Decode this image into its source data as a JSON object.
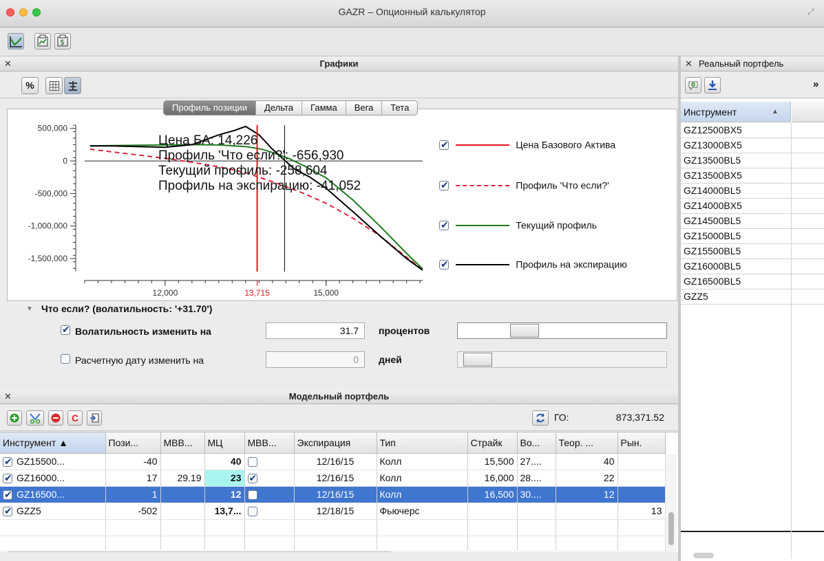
{
  "window": {
    "title": "GAZR – Опционный калькулятор"
  },
  "graphs_panel": {
    "title": "Графики",
    "toolbar": {
      "percent_label": "%"
    },
    "tabs": [
      {
        "label": "Профиль позиции",
        "active": true
      },
      {
        "label": "Дельта",
        "active": false
      },
      {
        "label": "Гамма",
        "active": false
      },
      {
        "label": "Вега",
        "active": false
      },
      {
        "label": "Тета",
        "active": false
      }
    ],
    "info_lines": [
      "Цена БА: 14,226",
      "Профиль 'Что если?': -656,930",
      "Текущий профиль: -258,604",
      "Профиль на экспирацию: -41,052"
    ],
    "legend": [
      {
        "label": "Цена Базового Актива",
        "checked": true,
        "color": "#e8151c",
        "style": "solid"
      },
      {
        "label": "Профиль 'Что если?'",
        "checked": true,
        "color": "#e0213c",
        "style": "dashed"
      },
      {
        "label": "Текущий профиль",
        "checked": true,
        "color": "#1f7a1f",
        "style": "solid"
      },
      {
        "label": "Профиль на экспирацию",
        "checked": true,
        "color": "#000000",
        "style": "solid"
      }
    ]
  },
  "chart_data": {
    "type": "line",
    "title": "",
    "xlabel": "",
    "ylabel": "",
    "xlim": [
      10500,
      16800
    ],
    "ylim": [
      -1700000,
      550000
    ],
    "x_ticks": [
      {
        "value": 12000,
        "label": "12,000",
        "color": "#333333"
      },
      {
        "value": 13715,
        "label": "13,715",
        "color": "#e8151c"
      },
      {
        "value": 15000,
        "label": "15,000",
        "color": "#333333"
      }
    ],
    "y_ticks": [
      {
        "value": 500000,
        "label": "500,000"
      },
      {
        "value": 0,
        "label": "0"
      },
      {
        "value": -500000,
        "label": "-500,000"
      },
      {
        "value": -1000000,
        "label": "-1,000,000"
      },
      {
        "value": -1500000,
        "label": "-1,500,000"
      }
    ],
    "vertical_markers": [
      {
        "name": "Цена Базового Актива",
        "x": 13715,
        "color": "#e8151c"
      },
      {
        "name": "cursor",
        "x": 14226,
        "color": "#000000"
      }
    ],
    "series": [
      {
        "name": "Профиль 'Что если?'",
        "color": "#e0213c",
        "dash": true,
        "x": [
          10600,
          11000,
          11500,
          12000,
          12500,
          13000,
          13500,
          14000,
          14500,
          15000,
          15500,
          16000,
          16500,
          16800
        ],
        "y": [
          180000,
          140000,
          90000,
          40000,
          -20000,
          -90000,
          -180000,
          -320000,
          -470000,
          -650000,
          -880000,
          -1150000,
          -1480000,
          -1670000
        ]
      },
      {
        "name": "Текущий профиль",
        "color": "#1f7a1f",
        "dash": false,
        "x": [
          10600,
          11000,
          11500,
          12000,
          12500,
          13000,
          13500,
          13800,
          14000,
          14300,
          14600,
          15000,
          15500,
          16000,
          16500,
          16800
        ],
        "y": [
          230000,
          235000,
          240000,
          245000,
          250000,
          245000,
          220000,
          180000,
          130000,
          40000,
          -80000,
          -260000,
          -600000,
          -1000000,
          -1420000,
          -1660000
        ]
      },
      {
        "name": "Профиль на экспирацию",
        "color": "#000000",
        "dash": false,
        "x": [
          10600,
          11000,
          11500,
          12000,
          12500,
          13000,
          13300,
          13500,
          13750,
          14000,
          14200,
          14400,
          14700,
          15000,
          15500,
          16000,
          16500,
          16800
        ],
        "y": [
          230000,
          230000,
          220000,
          210000,
          250000,
          400000,
          470000,
          530000,
          400000,
          180000,
          30000,
          -120000,
          -250000,
          -420000,
          -780000,
          -1150000,
          -1500000,
          -1680000
        ]
      }
    ]
  },
  "whatif": {
    "title": "Что если? (волатильность: '+31.70')",
    "vol": {
      "label": "Волатильность изменить на",
      "value": "31.7",
      "unit": "процентов",
      "checked": true,
      "level": 0.29
    },
    "date": {
      "label": "Расчетную дату изменить на",
      "value": "0",
      "unit": "дней",
      "checked": false,
      "level": 0.0
    }
  },
  "model_portfolio": {
    "title": "Модельный портфель",
    "go_label": "ГО:",
    "go_value": "873,371.52",
    "columns": [
      "Инструмент ▲",
      "Пози...",
      "МВВ...",
      "МЦ",
      "МВВ...",
      "Экспирация",
      "Тип",
      "Страйк",
      "Во...",
      "Теор. ...",
      "Рын."
    ],
    "rows": [
      {
        "checked": true,
        "instrument": "GZ15500...",
        "pos": "-40",
        "mvv": "",
        "mc": "40",
        "mvv2": false,
        "exp": "12/16/15",
        "type": "Колл",
        "strike": "15,500",
        "vol": "27....",
        "theor": "40",
        "market": "",
        "selected": false,
        "mc_highlight": false
      },
      {
        "checked": true,
        "instrument": "GZ16000...",
        "pos": "17",
        "mvv": "29.19",
        "mc": "23",
        "mvv2": true,
        "exp": "12/16/15",
        "type": "Колл",
        "strike": "16,000",
        "vol": "28....",
        "theor": "22",
        "market": "",
        "selected": false,
        "mc_highlight": true
      },
      {
        "checked": true,
        "instrument": "GZ16500...",
        "pos": "1",
        "mvv": "",
        "mc": "12",
        "mvv2": false,
        "exp": "12/16/15",
        "type": "Колл",
        "strike": "16,500",
        "vol": "30....",
        "theor": "12",
        "market": "",
        "selected": true,
        "mc_highlight": false
      },
      {
        "checked": true,
        "instrument": "GZZ5",
        "pos": "-502",
        "mvv": "",
        "mc": "13,7...",
        "mvv2": false,
        "exp": "12/18/15",
        "type": "Фьючерс",
        "strike": "",
        "vol": "",
        "theor": "",
        "market": "13",
        "selected": false,
        "mc_highlight": false
      }
    ]
  },
  "real_portfolio": {
    "title": "Реальный портфель",
    "column": "Инструмент",
    "items": [
      "GZ12500BX5",
      "GZ13000BX5",
      "GZ13500BL5",
      "GZ13500BX5",
      "GZ14000BL5",
      "GZ14000BX5",
      "GZ14500BL5",
      "GZ15000BL5",
      "GZ15500BL5",
      "GZ16000BL5",
      "GZ16500BL5",
      "GZZ5"
    ]
  }
}
